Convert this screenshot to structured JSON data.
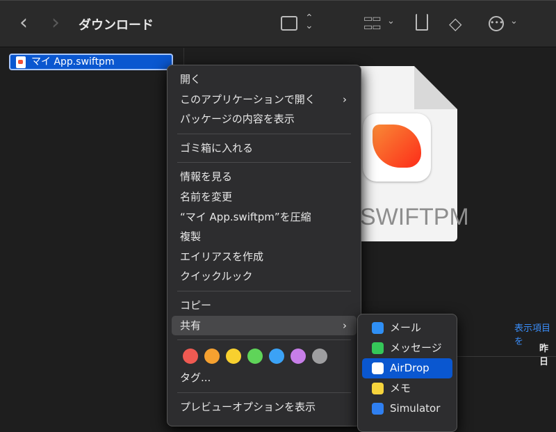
{
  "toolbar": {
    "title": "ダウンロード",
    "back": "‹",
    "forward": "›"
  },
  "sidebar": {
    "selected_file": "マイ App.swiftpm"
  },
  "preview": {
    "type_label": "SWIFTPM"
  },
  "info": {
    "show_more": "表示項目を",
    "date": "昨日"
  },
  "menu": {
    "items": [
      {
        "label": "開く"
      },
      {
        "label": "このアプリケーションで開く",
        "submenu": true
      },
      {
        "label": "パッケージの内容を表示"
      },
      {
        "sep": true
      },
      {
        "label": "ゴミ箱に入れる"
      },
      {
        "sep": true
      },
      {
        "label": "情報を見る"
      },
      {
        "label": "名前を変更"
      },
      {
        "label": "“マイ App.swiftpm”を圧縮"
      },
      {
        "label": "複製"
      },
      {
        "label": "エイリアスを作成"
      },
      {
        "label": "クイックルック"
      },
      {
        "sep": true
      },
      {
        "label": "コピー"
      },
      {
        "label": "共有",
        "submenu": true,
        "highlighted": true
      },
      {
        "sep": true
      },
      {
        "tags": true
      },
      {
        "label": "タグ..."
      },
      {
        "sep": true
      },
      {
        "label": "プレビューオプションを表示"
      }
    ],
    "tag_colors": [
      "#ef5a52",
      "#f6a130",
      "#f8d02f",
      "#5fd459",
      "#3ba2f6",
      "#c77ee8",
      "#9e9ea0"
    ]
  },
  "share_menu": {
    "items": [
      {
        "label": "メール",
        "icon": "mail-icon",
        "color": "#2f8ff5"
      },
      {
        "label": "メッセージ",
        "icon": "messages-icon",
        "color": "#35c759"
      },
      {
        "label": "AirDrop",
        "icon": "airdrop-icon",
        "color": "#ffffff",
        "highlighted": true
      },
      {
        "label": "メモ",
        "icon": "notes-icon",
        "color": "#f5d33c"
      },
      {
        "label": "Simulator",
        "icon": "simulator-icon",
        "color": "#2f7ff0"
      }
    ]
  }
}
